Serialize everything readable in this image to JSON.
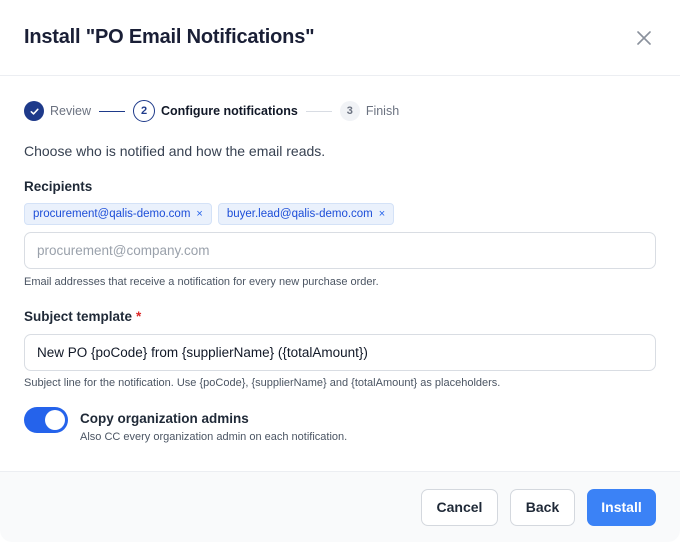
{
  "dialog": {
    "title": "Install \"PO Email Notifications\"",
    "close_icon": "close-icon"
  },
  "stepper": {
    "steps": [
      {
        "label": "Review",
        "status": "done",
        "marker": "✓"
      },
      {
        "label": "Configure notifications",
        "status": "active",
        "marker": "2"
      },
      {
        "label": "Finish",
        "status": "todo",
        "marker": "3"
      }
    ]
  },
  "intro": "Choose who is notified and how the email reads.",
  "recipients": {
    "label": "Recipients",
    "chips": [
      {
        "email": "procurement@qalis-demo.com",
        "remove": "×"
      },
      {
        "email": "buyer.lead@qalis-demo.com",
        "remove": "×"
      }
    ],
    "placeholder": "procurement@company.com",
    "help": "Email addresses that receive a notification for every new purchase order."
  },
  "subject": {
    "label": "Subject template",
    "required_mark": "*",
    "value": "New PO {poCode} from {supplierName} ({totalAmount})",
    "help": "Subject line for the notification. Use {poCode}, {supplierName} and {totalAmount} as placeholders."
  },
  "copy_admins": {
    "enabled": true,
    "title": "Copy organization admins",
    "description": "Also CC every organization admin on each notification."
  },
  "footer": {
    "cancel_label": "Cancel",
    "back_label": "Back",
    "install_label": "Install"
  },
  "colors": {
    "accent": "#3b82f6",
    "step_dark": "#1e3a8a",
    "chip_bg": "#eaf1fc",
    "required": "#dc2626"
  }
}
